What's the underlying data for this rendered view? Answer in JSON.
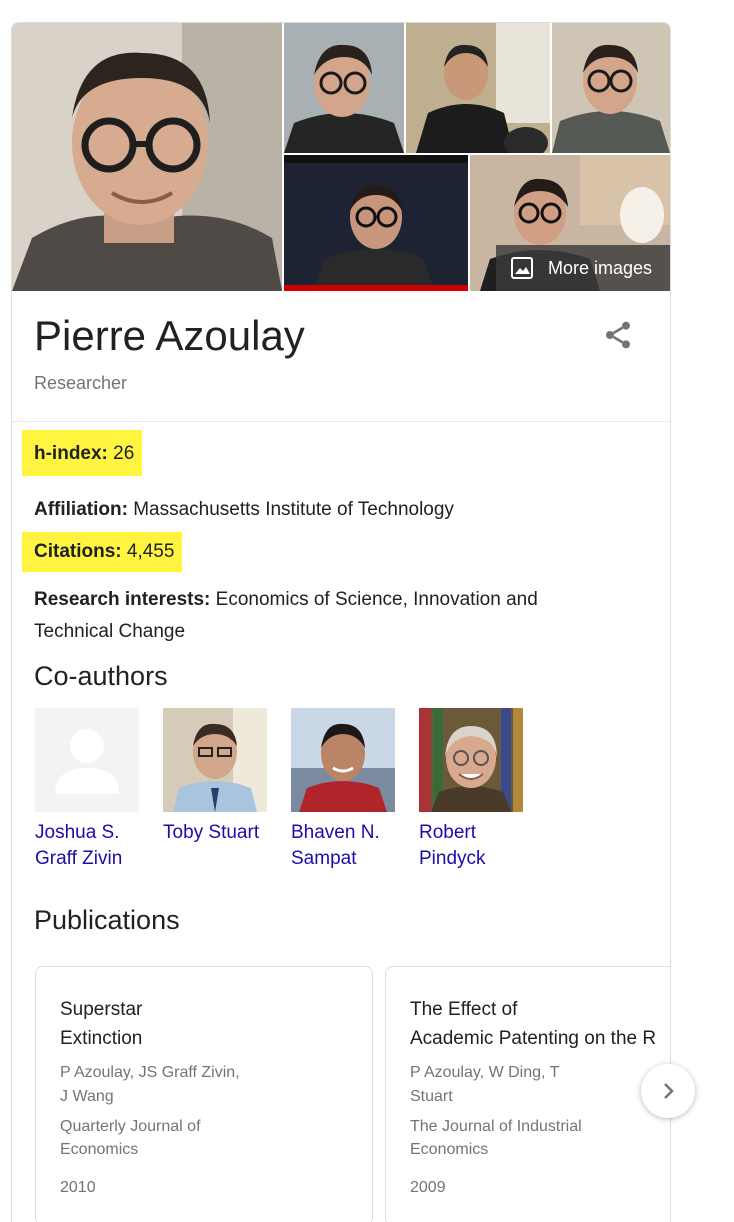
{
  "gallery": {
    "more_images_label": "More images"
  },
  "entity": {
    "name": "Pierre Azoulay",
    "type": "Researcher"
  },
  "facts": [
    {
      "label": "h-index:",
      "value": " 26",
      "highlighted": true
    },
    {
      "label": "Affiliation:",
      "value": " Massachusetts Institute of Technology",
      "highlighted": false
    },
    {
      "label": "Citations:",
      "value": " 4,455",
      "highlighted": true
    },
    {
      "label": "Research interests:",
      "value": " Economics of Science, Innovation and Technical Change",
      "highlighted": false
    }
  ],
  "coauthors": {
    "heading": "Co-authors",
    "items": [
      {
        "line1": "Joshua S.",
        "line2": "Graff Zivin"
      },
      {
        "line1": "Toby Stuart",
        "line2": ""
      },
      {
        "line1": "Bhaven N.",
        "line2": "Sampat"
      },
      {
        "line1": "Robert",
        "line2": "Pindyck"
      }
    ]
  },
  "publications": {
    "heading": "Publications",
    "items": [
      {
        "title": "Superstar\nExtinction",
        "authors": "P Azoulay, JS Graff Zivin,\nJ Wang",
        "journal": "Quarterly Journal of\nEconomics",
        "year": "2010"
      },
      {
        "title": "The Effect of\nAcademic Patenting on the R",
        "authors": "P Azoulay, W Ding, T\nStuart",
        "journal": "The Journal of Industrial\nEconomics",
        "year": "2009"
      }
    ]
  },
  "colors": {
    "highlight": "#fff540",
    "link": "#1a0dab",
    "secondary_text": "#70757a"
  },
  "icons": {
    "share": "share-icon",
    "more_images": "image-icon",
    "next": "chevron-right-icon"
  }
}
